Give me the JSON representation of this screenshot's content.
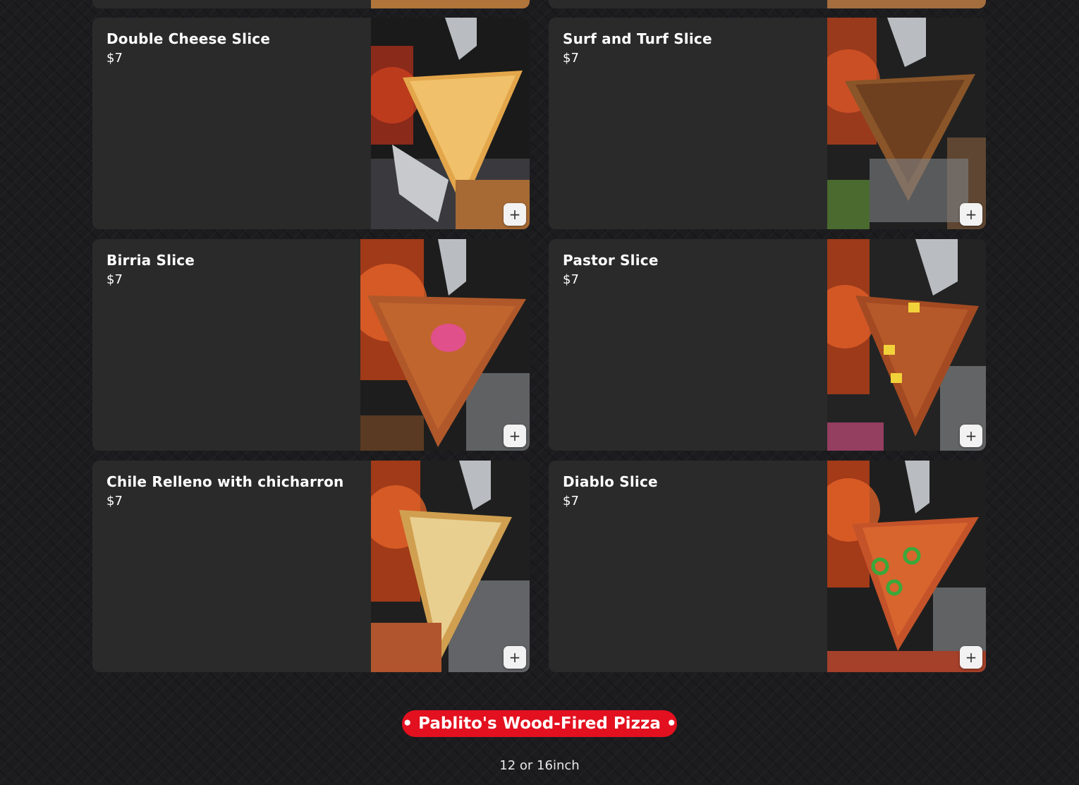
{
  "menu_items": [
    {
      "name": "Double Cheese Slice",
      "price": "$7",
      "add_label": "+"
    },
    {
      "name": "Surf and Turf Slice",
      "price": "$7",
      "add_label": "+"
    },
    {
      "name": "Birria Slice",
      "price": "$7",
      "add_label": "+"
    },
    {
      "name": "Pastor Slice",
      "price": "$7",
      "add_label": "+"
    },
    {
      "name": "Chile Relleno with chicharron",
      "price": "$7",
      "add_label": "+"
    },
    {
      "name": "Diablo Slice",
      "price": "$7",
      "add_label": "+"
    }
  ],
  "section": {
    "title": "• Pablito's Wood-Fired Pizza •",
    "subtitle": "12 or 16inch"
  },
  "colors": {
    "background": "#1c1c1f",
    "card": "#2a2a2a",
    "accent_red": "#e3101f"
  }
}
